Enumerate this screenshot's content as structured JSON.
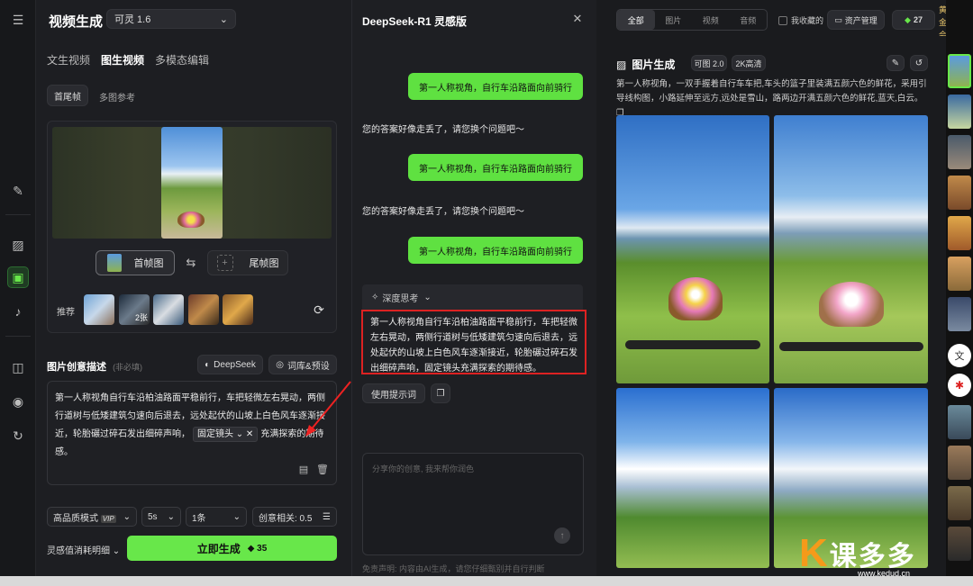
{
  "nav": {
    "items": [
      "menu-icon",
      "brush-icon",
      "image-icon",
      "video-icon",
      "audio-icon",
      "model-icon",
      "eye-icon",
      "history-icon"
    ]
  },
  "left": {
    "title": "视频生成",
    "model": "可灵 1.6",
    "tabs": [
      "文生视频",
      "图生视频",
      "多模态编辑"
    ],
    "subtabs": [
      "首尾帧",
      "多图参考"
    ],
    "first_frame": "首帧图",
    "last_frame": "尾帧图",
    "recommend": "推荐",
    "thumb_badge": "2张",
    "desc_title": "图片创意描述",
    "desc_hint": "(非必填)",
    "deepseek_btn": "DeepSeek",
    "library_btn": "词库&预设",
    "prompt_text": "第一人称视角自行车沿柏油路面平稳前行，车把轻微左右晃动，两侧行道树与低矮建筑匀速向后退去，远处起伏的山坡上白色风车逐渐接近，轮胎碾过碎石发出细碎声响，",
    "tag": "固定镜头",
    "prompt_tail": "充满探索的期待感。",
    "quality": "高品质模式",
    "vip": "VIP",
    "duration": "5s",
    "count": "1条",
    "relevance": "创意相关: 0.5",
    "consume": "灵感值消耗明细",
    "generate": "立即生成",
    "cost": "35"
  },
  "mid": {
    "title": "DeepSeek-R1 灵感版",
    "user_msg": "第一人称视角，自行车沿路面向前骑行",
    "bot_msg": "您的答案好像走丢了，请您换个问题吧～",
    "think": "深度思考",
    "answer": "第一人称视角自行车沿柏油路面平稳前行，车把轻微左右晃动，两侧行道树与低矮建筑匀速向后退去，远处起伏的山坡上白色风车逐渐接近，轮胎碾过碎石发出细碎声响，固定镜头充满探索的期待感。",
    "use_prompt": "使用提示词",
    "input_placeholder": "分享你的创意, 我来帮你润色",
    "disclaimer": "免责声明: 内容由AI生成，请您仔细甄别并自行判断"
  },
  "right": {
    "filters": [
      "全部",
      "图片",
      "视频",
      "音频"
    ],
    "favorites": "我收藏的",
    "assets": "资产管理",
    "points": "27",
    "member": "黄金会员",
    "section_title": "图片生成",
    "model": "可图 2.0",
    "quality": "2K高清",
    "prompt": "第一人称视角，一双手握着自行车车把,车头的篮子里装满五颜六色的鲜花，采用引导线构图，小路延伸至远方,远处是雪山，路两边开满五颜六色的鲜花,蓝天,白云。"
  },
  "watermark": "课多多",
  "watermark_url": "www.kedud.cn"
}
